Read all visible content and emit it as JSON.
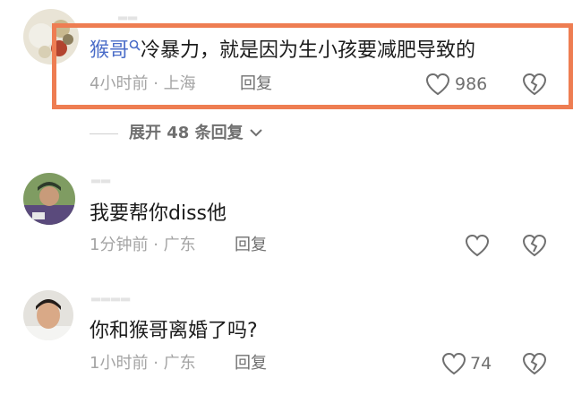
{
  "comments": [
    {
      "username": "猴哥",
      "body": "冷暴力，就是因为生小孩要减肥导致的",
      "time": "4小时前",
      "location": "上海",
      "reply_label": "回复",
      "like_count": "986"
    },
    {
      "username": "",
      "body": "我要帮你diss他",
      "time": "1分钟前",
      "location": "广东",
      "reply_label": "回复",
      "like_count": ""
    },
    {
      "username": "",
      "body": "你和猴哥离婚了吗?",
      "time": "1小时前",
      "location": "广东",
      "reply_label": "回复",
      "like_count": "74"
    }
  ],
  "expand_replies_label": "展开 48 条回复",
  "meta_separator": "·",
  "colors": {
    "highlight_border": "#ee7d52",
    "author_link": "#4a6cc8",
    "meta_text": "#a4a4a4",
    "action_text": "#6f6f6f"
  },
  "icons": [
    "search-icon",
    "heart-icon",
    "dislike-heart-icon",
    "chevron-down-icon"
  ]
}
